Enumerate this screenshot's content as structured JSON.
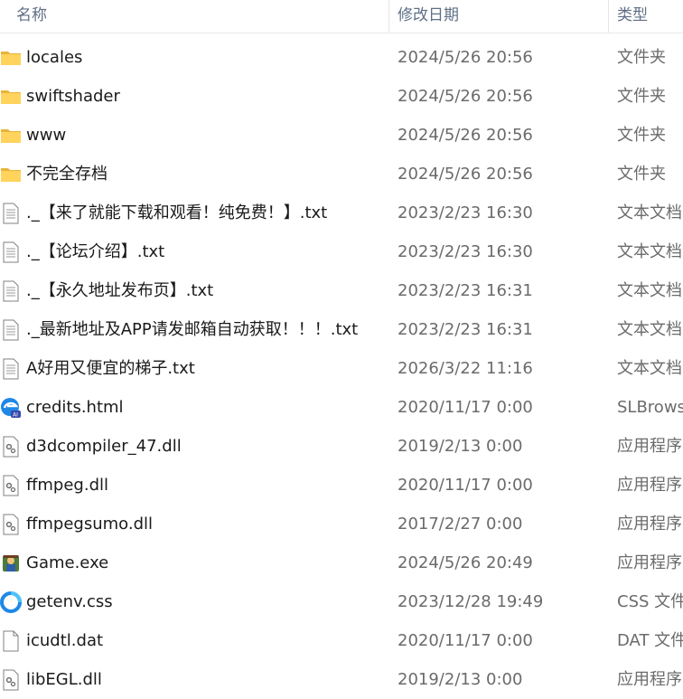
{
  "header": {
    "name": "名称",
    "date": "修改日期",
    "type": "类型"
  },
  "files": [
    {
      "icon": "folder-icon",
      "name": "locales",
      "date": "2024/5/26 20:56",
      "type": "文件夹"
    },
    {
      "icon": "folder-icon",
      "name": "swiftshader",
      "date": "2024/5/26 20:56",
      "type": "文件夹"
    },
    {
      "icon": "folder-icon",
      "name": "www",
      "date": "2024/5/26 20:56",
      "type": "文件夹"
    },
    {
      "icon": "folder-icon",
      "name": "不完全存档",
      "date": "2024/5/26 20:56",
      "type": "文件夹"
    },
    {
      "icon": "text-file-icon",
      "name": "._【来了就能下载和观看！纯免费！】.txt",
      "date": "2023/2/23 16:30",
      "type": "文本文档"
    },
    {
      "icon": "text-file-icon",
      "name": "._【论坛介绍】.txt",
      "date": "2023/2/23 16:30",
      "type": "文本文档"
    },
    {
      "icon": "text-file-icon",
      "name": "._【永久地址发布页】.txt",
      "date": "2023/2/23 16:31",
      "type": "文本文档"
    },
    {
      "icon": "text-file-icon",
      "name": "._最新地址及APP请发邮箱自动获取！！！.txt",
      "date": "2023/2/23 16:31",
      "type": "文本文档"
    },
    {
      "icon": "text-file-icon",
      "name": "A好用又便宜的梯子.txt",
      "date": "2026/3/22 11:16",
      "type": "文本文档"
    },
    {
      "icon": "browser-html-icon",
      "name": "credits.html",
      "date": "2020/11/17 0:00",
      "type": "SLBrowser"
    },
    {
      "icon": "dll-file-icon",
      "name": "d3dcompiler_47.dll",
      "date": "2019/2/13 0:00",
      "type": "应用程序"
    },
    {
      "icon": "dll-file-icon",
      "name": "ffmpeg.dll",
      "date": "2020/11/17 0:00",
      "type": "应用程序"
    },
    {
      "icon": "dll-file-icon",
      "name": "ffmpegsumo.dll",
      "date": "2017/2/27 0:00",
      "type": "应用程序"
    },
    {
      "icon": "game-exe-icon",
      "name": "Game.exe",
      "date": "2024/5/26 20:49",
      "type": "应用程序"
    },
    {
      "icon": "css-file-icon",
      "name": "getenv.css",
      "date": "2023/12/28 19:49",
      "type": "CSS 文件"
    },
    {
      "icon": "blank-file-icon",
      "name": "icudtl.dat",
      "date": "2020/11/17 0:00",
      "type": "DAT 文件"
    },
    {
      "icon": "dll-file-icon",
      "name": "libEGL.dll",
      "date": "2019/2/13 0:00",
      "type": "应用程序"
    }
  ]
}
